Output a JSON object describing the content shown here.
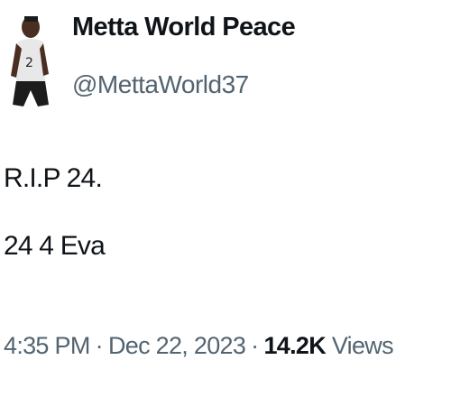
{
  "author": {
    "display_name": "Metta World Peace",
    "handle": "@MettaWorld37",
    "avatar_icon": "profile-photo-avatar"
  },
  "tweet": {
    "lines": [
      "R.I.P 24.",
      "24 4 Eva"
    ]
  },
  "meta": {
    "time": "4:35 PM",
    "separator": "·",
    "date": "Dec 22, 2023",
    "views_count": "14.2K",
    "views_label": "Views"
  },
  "colors": {
    "primary_text": "#0f1419",
    "secondary_text": "#536471",
    "background": "#ffffff"
  }
}
